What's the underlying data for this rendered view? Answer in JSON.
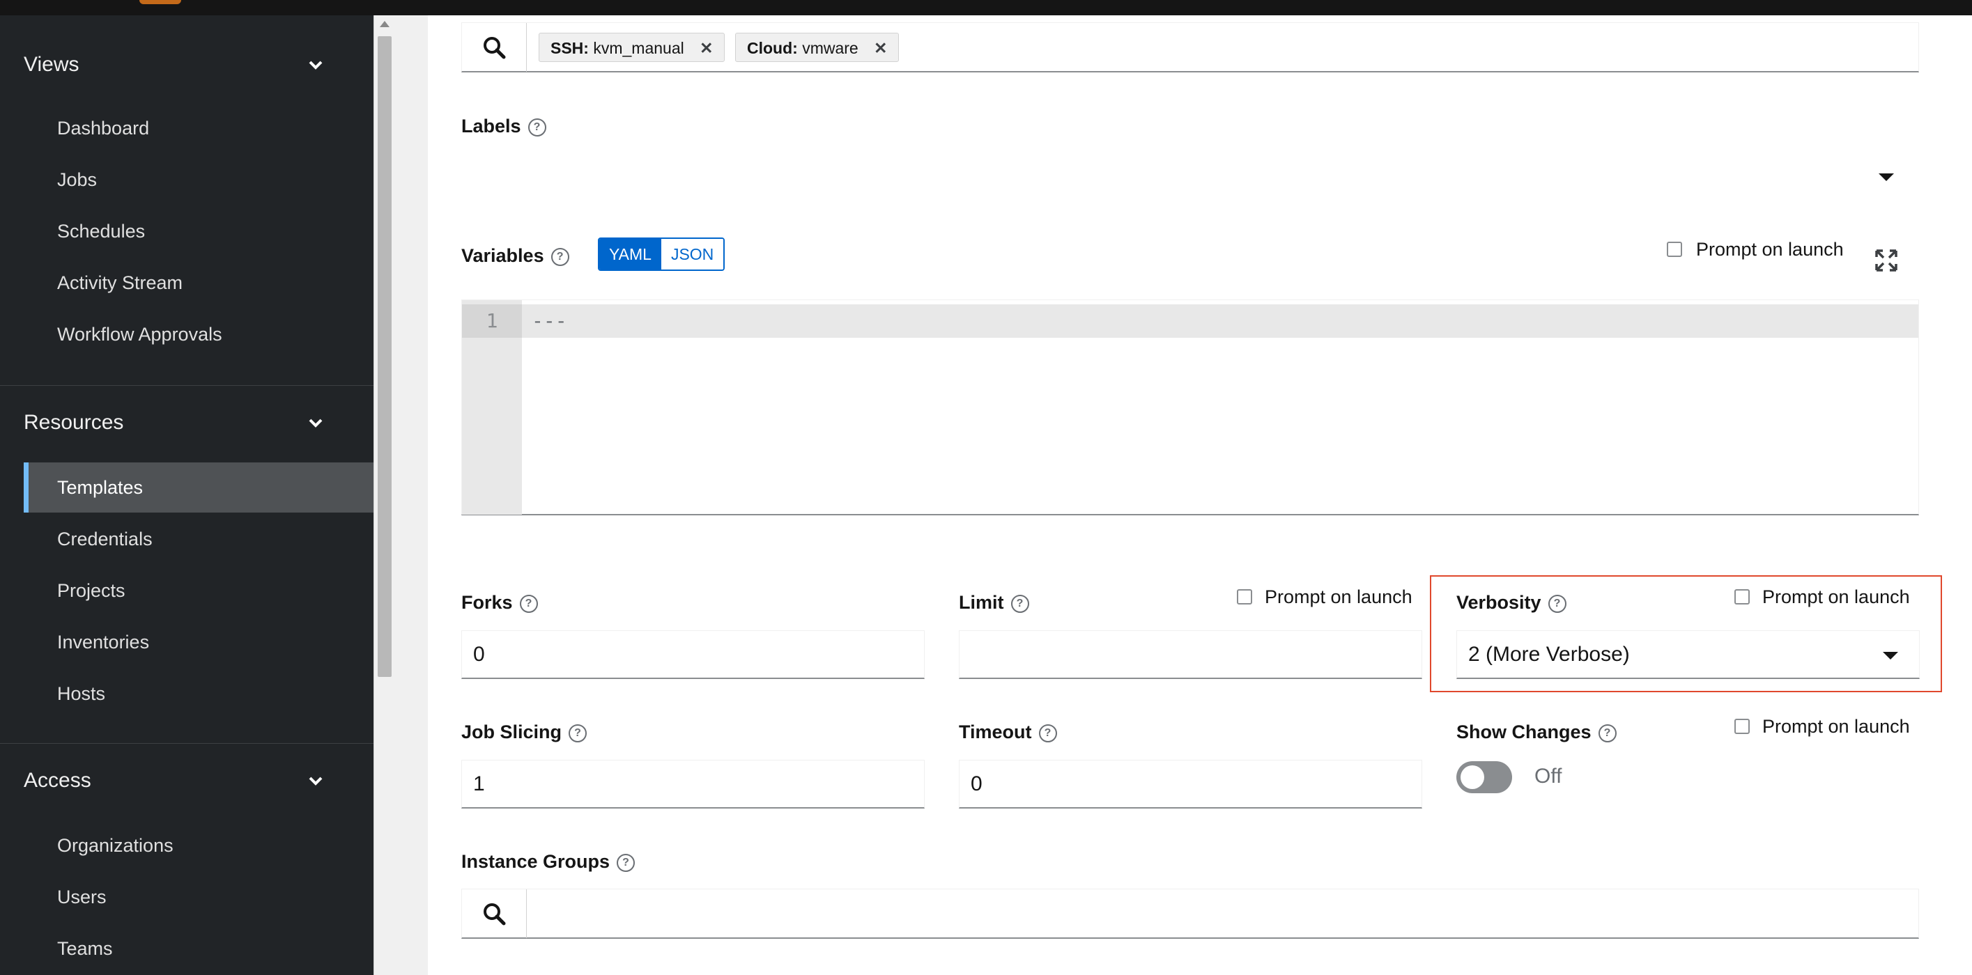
{
  "sidebar": {
    "groups": [
      {
        "title": "Views",
        "items": [
          "Dashboard",
          "Jobs",
          "Schedules",
          "Activity Stream",
          "Workflow Approvals"
        ]
      },
      {
        "title": "Resources",
        "items": [
          "Templates",
          "Credentials",
          "Projects",
          "Inventories",
          "Hosts"
        ]
      },
      {
        "title": "Access",
        "items": [
          "Organizations",
          "Users",
          "Teams"
        ]
      }
    ],
    "active_item": "Templates"
  },
  "credentials": {
    "chips": [
      {
        "key": "SSH:",
        "value": "kvm_manual"
      },
      {
        "key": "Cloud:",
        "value": "vmware"
      }
    ]
  },
  "labels": {
    "title": "Labels"
  },
  "variables": {
    "title": "Variables",
    "formats": [
      "YAML",
      "JSON"
    ],
    "selected_format": "YAML",
    "prompt_label": "Prompt on launch",
    "lines": [
      {
        "no": "1",
        "text": "---"
      }
    ]
  },
  "forks": {
    "title": "Forks",
    "value": "0"
  },
  "limit": {
    "title": "Limit",
    "value": "",
    "prompt_label": "Prompt on launch"
  },
  "verbosity": {
    "title": "Verbosity",
    "value": "2 (More Verbose)",
    "prompt_label": "Prompt on launch"
  },
  "job_slicing": {
    "title": "Job Slicing",
    "value": "1"
  },
  "timeout": {
    "title": "Timeout",
    "value": "0"
  },
  "show_changes": {
    "title": "Show Changes",
    "state": "Off",
    "prompt_label": "Prompt on launch"
  },
  "instance_groups": {
    "title": "Instance Groups"
  },
  "colors": {
    "accent": "#0066cc",
    "highlight": "#e0482d",
    "sidebar_bg": "#212427"
  }
}
